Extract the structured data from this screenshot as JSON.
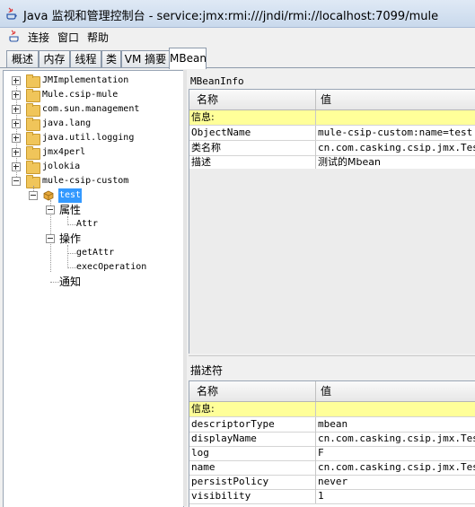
{
  "window": {
    "title": "Java 监视和管理控制台 - service:jmx:rmi:///jndi/rmi://localhost:7099/mule"
  },
  "menu": {
    "items": [
      "连接",
      "窗口",
      "帮助"
    ]
  },
  "tabs": [
    "概述",
    "内存",
    "线程",
    "类",
    "VM 摘要",
    "MBean"
  ],
  "active_tab": "MBean",
  "tree": {
    "domains": [
      "JMImplementation",
      "Mule.csip-mule",
      "com.sun.management",
      "java.lang",
      "java.util.logging",
      "jmx4perl",
      "jolokia",
      "mule-csip-custom"
    ],
    "bean": "test",
    "attributes_label": "属性",
    "attribute": "Attr",
    "operations_label": "操作",
    "operations": [
      "getAttr",
      "execOperation"
    ],
    "notifications_label": "通知"
  },
  "mbeaninfo": {
    "section_label": "MBeanInfo",
    "col_name": "名称",
    "col_value": "值",
    "rows": [
      {
        "name": "信息:",
        "value": "",
        "highlight": true
      },
      {
        "name": "ObjectName",
        "value": "mule-csip-custom:name=test"
      },
      {
        "name": "类名称",
        "value": "cn.com.casking.csip.jmx.Test"
      },
      {
        "name": "描述",
        "value": "测试的Mbean"
      }
    ]
  },
  "descriptor": {
    "section_label": "描述符",
    "col_name": "名称",
    "col_value": "值",
    "rows": [
      {
        "name": "信息:",
        "value": "",
        "highlight": true
      },
      {
        "name": "descriptorType",
        "value": "mbean"
      },
      {
        "name": "displayName",
        "value": "cn.com.casking.csip.jmx.Test"
      },
      {
        "name": "log",
        "value": "F"
      },
      {
        "name": "name",
        "value": "cn.com.casking.csip.jmx.Test"
      },
      {
        "name": "persistPolicy",
        "value": "never"
      },
      {
        "name": "visibility",
        "value": "1"
      }
    ]
  },
  "colors": {
    "info_row": "#ffff99",
    "selection": "#3399ff",
    "folder": "#f0c55a"
  }
}
